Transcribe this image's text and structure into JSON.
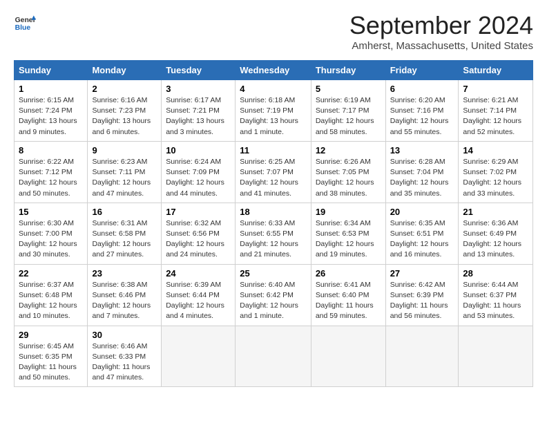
{
  "logo": {
    "line1": "General",
    "line2": "Blue"
  },
  "title": "September 2024",
  "location": "Amherst, Massachusetts, United States",
  "days_of_week": [
    "Sunday",
    "Monday",
    "Tuesday",
    "Wednesday",
    "Thursday",
    "Friday",
    "Saturday"
  ],
  "weeks": [
    [
      {
        "day": "1",
        "sunrise": "6:15 AM",
        "sunset": "7:24 PM",
        "daylight": "13 hours and 9 minutes."
      },
      {
        "day": "2",
        "sunrise": "6:16 AM",
        "sunset": "7:23 PM",
        "daylight": "13 hours and 6 minutes."
      },
      {
        "day": "3",
        "sunrise": "6:17 AM",
        "sunset": "7:21 PM",
        "daylight": "13 hours and 3 minutes."
      },
      {
        "day": "4",
        "sunrise": "6:18 AM",
        "sunset": "7:19 PM",
        "daylight": "13 hours and 1 minute."
      },
      {
        "day": "5",
        "sunrise": "6:19 AM",
        "sunset": "7:17 PM",
        "daylight": "12 hours and 58 minutes."
      },
      {
        "day": "6",
        "sunrise": "6:20 AM",
        "sunset": "7:16 PM",
        "daylight": "12 hours and 55 minutes."
      },
      {
        "day": "7",
        "sunrise": "6:21 AM",
        "sunset": "7:14 PM",
        "daylight": "12 hours and 52 minutes."
      }
    ],
    [
      {
        "day": "8",
        "sunrise": "6:22 AM",
        "sunset": "7:12 PM",
        "daylight": "12 hours and 50 minutes."
      },
      {
        "day": "9",
        "sunrise": "6:23 AM",
        "sunset": "7:11 PM",
        "daylight": "12 hours and 47 minutes."
      },
      {
        "day": "10",
        "sunrise": "6:24 AM",
        "sunset": "7:09 PM",
        "daylight": "12 hours and 44 minutes."
      },
      {
        "day": "11",
        "sunrise": "6:25 AM",
        "sunset": "7:07 PM",
        "daylight": "12 hours and 41 minutes."
      },
      {
        "day": "12",
        "sunrise": "6:26 AM",
        "sunset": "7:05 PM",
        "daylight": "12 hours and 38 minutes."
      },
      {
        "day": "13",
        "sunrise": "6:28 AM",
        "sunset": "7:04 PM",
        "daylight": "12 hours and 35 minutes."
      },
      {
        "day": "14",
        "sunrise": "6:29 AM",
        "sunset": "7:02 PM",
        "daylight": "12 hours and 33 minutes."
      }
    ],
    [
      {
        "day": "15",
        "sunrise": "6:30 AM",
        "sunset": "7:00 PM",
        "daylight": "12 hours and 30 minutes."
      },
      {
        "day": "16",
        "sunrise": "6:31 AM",
        "sunset": "6:58 PM",
        "daylight": "12 hours and 27 minutes."
      },
      {
        "day": "17",
        "sunrise": "6:32 AM",
        "sunset": "6:56 PM",
        "daylight": "12 hours and 24 minutes."
      },
      {
        "day": "18",
        "sunrise": "6:33 AM",
        "sunset": "6:55 PM",
        "daylight": "12 hours and 21 minutes."
      },
      {
        "day": "19",
        "sunrise": "6:34 AM",
        "sunset": "6:53 PM",
        "daylight": "12 hours and 19 minutes."
      },
      {
        "day": "20",
        "sunrise": "6:35 AM",
        "sunset": "6:51 PM",
        "daylight": "12 hours and 16 minutes."
      },
      {
        "day": "21",
        "sunrise": "6:36 AM",
        "sunset": "6:49 PM",
        "daylight": "12 hours and 13 minutes."
      }
    ],
    [
      {
        "day": "22",
        "sunrise": "6:37 AM",
        "sunset": "6:48 PM",
        "daylight": "12 hours and 10 minutes."
      },
      {
        "day": "23",
        "sunrise": "6:38 AM",
        "sunset": "6:46 PM",
        "daylight": "12 hours and 7 minutes."
      },
      {
        "day": "24",
        "sunrise": "6:39 AM",
        "sunset": "6:44 PM",
        "daylight": "12 hours and 4 minutes."
      },
      {
        "day": "25",
        "sunrise": "6:40 AM",
        "sunset": "6:42 PM",
        "daylight": "12 hours and 1 minute."
      },
      {
        "day": "26",
        "sunrise": "6:41 AM",
        "sunset": "6:40 PM",
        "daylight": "11 hours and 59 minutes."
      },
      {
        "day": "27",
        "sunrise": "6:42 AM",
        "sunset": "6:39 PM",
        "daylight": "11 hours and 56 minutes."
      },
      {
        "day": "28",
        "sunrise": "6:44 AM",
        "sunset": "6:37 PM",
        "daylight": "11 hours and 53 minutes."
      }
    ],
    [
      {
        "day": "29",
        "sunrise": "6:45 AM",
        "sunset": "6:35 PM",
        "daylight": "11 hours and 50 minutes."
      },
      {
        "day": "30",
        "sunrise": "6:46 AM",
        "sunset": "6:33 PM",
        "daylight": "11 hours and 47 minutes."
      },
      null,
      null,
      null,
      null,
      null
    ]
  ]
}
